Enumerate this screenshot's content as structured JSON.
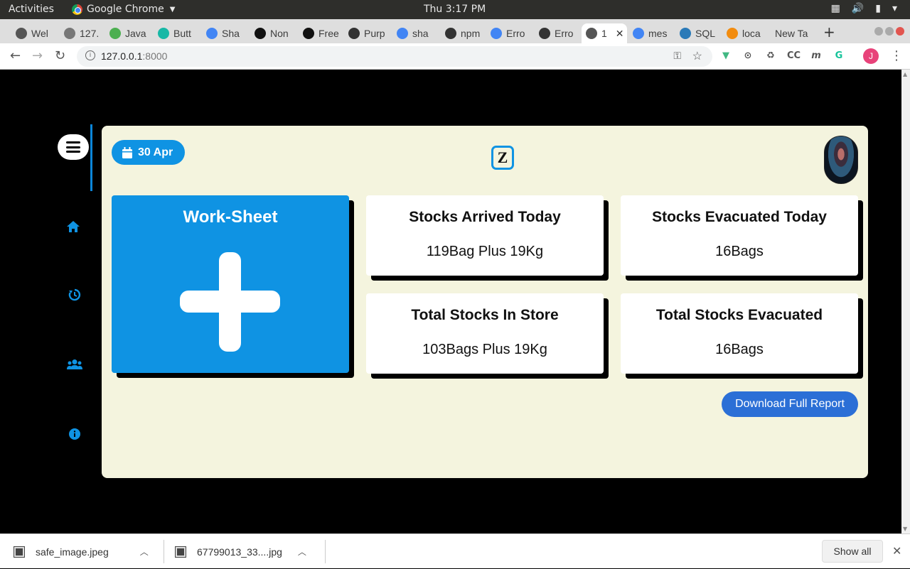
{
  "os_bar": {
    "activities": "Activities",
    "app_name": "Google Chrome",
    "clock": "Thu  3:17 PM"
  },
  "browser": {
    "tabs": [
      {
        "label": "Wel",
        "favicon": "generic-icon",
        "color": "#555555"
      },
      {
        "label": "127.",
        "favicon": "generic-icon",
        "color": "#777777"
      },
      {
        "label": "Java",
        "favicon": "w3-icon",
        "color": "#4caf50"
      },
      {
        "label": "Butt",
        "favicon": "bootstrap-icon",
        "color": "#17b8a6"
      },
      {
        "label": "Sha",
        "favicon": "drive-icon",
        "color": "#4285f4"
      },
      {
        "label": "Non",
        "favicon": "nda-icon",
        "color": "#111111"
      },
      {
        "label": "Free",
        "favicon": "nda-icon",
        "color": "#111111"
      },
      {
        "label": "Purp",
        "favicon": "github-icon",
        "color": "#333333"
      },
      {
        "label": "sha",
        "favicon": "google-icon",
        "color": "#4285f4"
      },
      {
        "label": "npm",
        "favicon": "github-icon",
        "color": "#333333"
      },
      {
        "label": "Erro",
        "favicon": "google-icon",
        "color": "#4285f4"
      },
      {
        "label": "Erro",
        "favicon": "github-icon",
        "color": "#333333"
      },
      {
        "label": "1",
        "favicon": "globe-icon",
        "color": "#555555",
        "active": true
      },
      {
        "label": "mes",
        "favicon": "google-icon",
        "color": "#4285f4"
      },
      {
        "label": "SQL",
        "favicon": "pencil-icon",
        "color": "#2a7ab8"
      },
      {
        "label": "loca",
        "favicon": "xampp-icon",
        "color": "#f28c0f"
      },
      {
        "label": "New Ta",
        "favicon": "",
        "color": ""
      }
    ],
    "url_host": "127.0.0.1",
    "url_port": ":8000"
  },
  "app": {
    "date": "30 Apr",
    "logo_letter": "Z",
    "worksheet_title": "Work-Sheet",
    "cards": [
      {
        "label": "Stocks Arrived Today",
        "value": "119Bag Plus 19Kg"
      },
      {
        "label": "Stocks Evacuated Today",
        "value": "16Bags"
      },
      {
        "label": "Total Stocks In Store",
        "value": "103Bags Plus 19Kg"
      },
      {
        "label": "Total Stocks Evacuated",
        "value": "16Bags"
      }
    ],
    "report_button": "Download Full Report",
    "nav_icons": [
      "home-icon",
      "history-icon",
      "users-icon",
      "info-icon"
    ],
    "accent_color": "#0f93e3",
    "panel_color": "#f4f4de"
  },
  "downloads": {
    "items": [
      "safe_image.jpeg",
      "67799013_33....jpg"
    ],
    "show_all": "Show all"
  }
}
